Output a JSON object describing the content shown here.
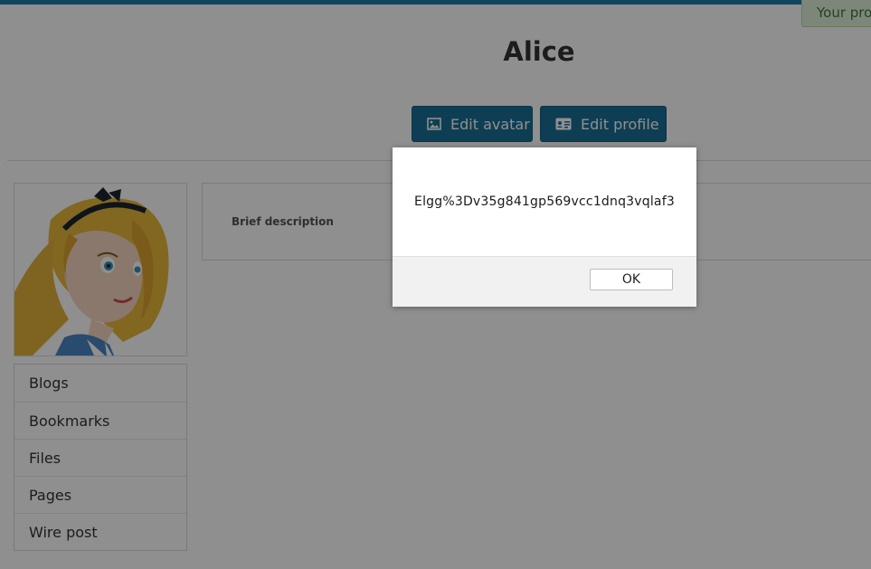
{
  "toast": {
    "text": "Your pro"
  },
  "profile": {
    "name": "Alice"
  },
  "actions": {
    "edit_avatar_label": "Edit avatar",
    "edit_profile_label": "Edit profile"
  },
  "owner_menu": {
    "items": [
      {
        "label": "Blogs"
      },
      {
        "label": "Bookmarks"
      },
      {
        "label": "Files"
      },
      {
        "label": "Pages"
      },
      {
        "label": "Wire post"
      }
    ]
  },
  "details": {
    "brief_description_label": "Brief description"
  },
  "alert": {
    "message": "Elgg%3Dv35g841gp569vcc1dnq3vqlaf3",
    "ok_label": "OK"
  },
  "colors": {
    "accent": "#1a6f96",
    "top_bar": "#1f7fa8",
    "toast_bg": "#dff0d8",
    "overlay": "rgba(0,0,0,0.44)"
  },
  "icons": {
    "edit_avatar": "image-icon",
    "edit_profile": "id-card-icon"
  }
}
